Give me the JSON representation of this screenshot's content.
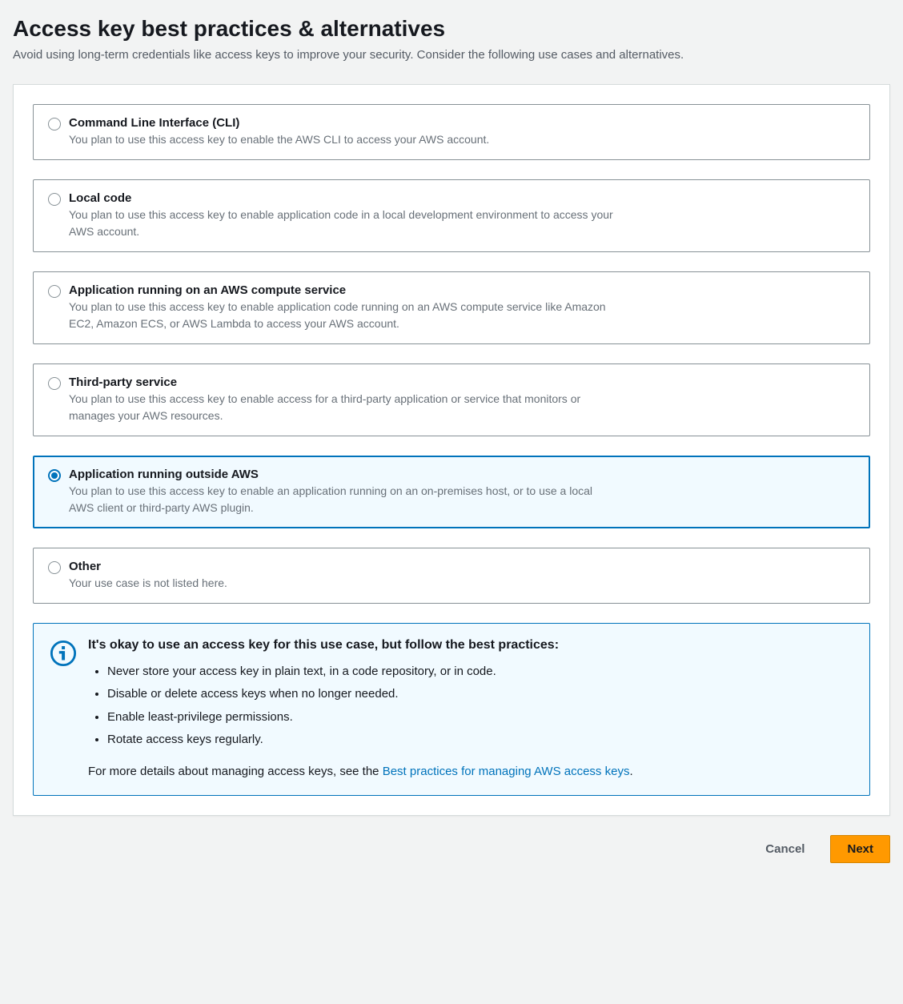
{
  "header": {
    "title": "Access key best practices & alternatives",
    "subtitle": "Avoid using long-term credentials like access keys to improve your security. Consider the following use cases and alternatives."
  },
  "options": [
    {
      "title": "Command Line Interface (CLI)",
      "desc": "You plan to use this access key to enable the AWS CLI to access your AWS account.",
      "selected": false
    },
    {
      "title": "Local code",
      "desc": "You plan to use this access key to enable application code in a local development environment to access your AWS account.",
      "selected": false
    },
    {
      "title": "Application running on an AWS compute service",
      "desc": "You plan to use this access key to enable application code running on an AWS compute service like Amazon EC2, Amazon ECS, or AWS Lambda to access your AWS account.",
      "selected": false
    },
    {
      "title": "Third-party service",
      "desc": "You plan to use this access key to enable access for a third-party application or service that monitors or manages your AWS resources.",
      "selected": false
    },
    {
      "title": "Application running outside AWS",
      "desc": "You plan to use this access key to enable an application running on an on-premises host, or to use a local AWS client or third-party AWS plugin.",
      "selected": true
    },
    {
      "title": "Other",
      "desc": "Your use case is not listed here.",
      "selected": false
    }
  ],
  "info": {
    "title": "It's okay to use an access key for this use case, but follow the best practices:",
    "bullets": [
      "Never store your access key in plain text, in a code repository, or in code.",
      "Disable or delete access keys when no longer needed.",
      "Enable least-privilege permissions.",
      "Rotate access keys regularly."
    ],
    "footer_prefix": "For more details about managing access keys, see the ",
    "footer_link": "Best practices for managing AWS access keys",
    "footer_suffix": "."
  },
  "buttons": {
    "cancel": "Cancel",
    "next": "Next"
  }
}
